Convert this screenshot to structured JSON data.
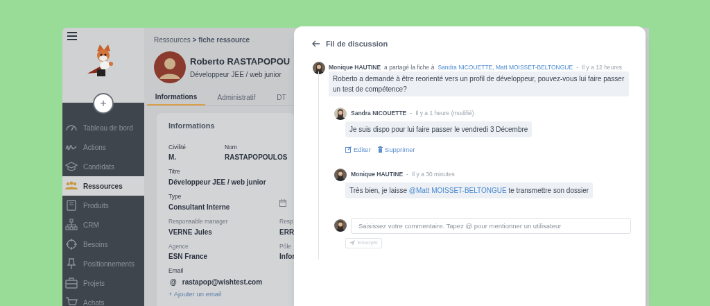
{
  "sidebar": {
    "nav": [
      {
        "label": "Tableau de bord",
        "selected": false
      },
      {
        "label": "Actions",
        "selected": false
      },
      {
        "label": "Candidats",
        "selected": false
      },
      {
        "label": "Ressources",
        "selected": true
      },
      {
        "label": "Produits",
        "selected": false
      },
      {
        "label": "CRM",
        "selected": false
      },
      {
        "label": "Besoins",
        "selected": false
      },
      {
        "label": "Positionnements",
        "selected": false
      },
      {
        "label": "Projets",
        "selected": false
      },
      {
        "label": "Achats",
        "selected": false
      }
    ]
  },
  "main": {
    "breadcrumb": "Ressources **> fiche ressource**",
    "profile": {
      "name": "Roberto RASTAPOPOU",
      "subtitle": "Développeur JEE / web junior"
    },
    "tabs": [
      {
        "label": "Informations",
        "selected": true
      },
      {
        "label": "Administratif",
        "selected": false
      },
      {
        "label": "DT",
        "selected": false
      }
    ],
    "card": {
      "title": "Informations",
      "rows": [
        [
          {
            "label": "Civilité",
            "value": "M."
          },
          {
            "label": "Nom",
            "value": "RASTAPOPOULOS"
          }
        ],
        [
          {
            "label": "Titre",
            "value": "Développeur JEE / web junior"
          }
        ],
        [
          {
            "label": "Type",
            "value": "Consultant Interne"
          },
          {
            "kind": "date"
          }
        ],
        [
          {
            "label": "Responsable manager",
            "value": "VERNE Jules"
          },
          {
            "label": "Resp",
            "value": "ERR"
          }
        ],
        [
          {
            "label": "Agence",
            "value": "ESN France"
          },
          {
            "label": "Pôle",
            "value": "Infor"
          }
        ]
      ],
      "email": {
        "label": "Email",
        "prefix": "@",
        "value": "rastapop@wishtest.com",
        "add": "+ Ajouter un email"
      }
    }
  },
  "discussion": {
    "title": "Fil de discussion",
    "comment": {
      "author": "Monique HAUTINE",
      "action": "a partagé la fiche à",
      "recipients": "Sandra NICOUETTE, Matt MOISSET-BELTONGUE",
      "separator": "-",
      "time": "Il y a 12 heures",
      "text": [
        {
          "kind": "text",
          "text": "Roberto a demandé à être reorienté vers un profil de développeur, pouvez-vous lui faire passer un test de compétence?"
        }
      ],
      "replies": [
        {
          "author": "Sandra NICOUETTE",
          "separator": "-",
          "time": "Il y a 1 heure (modifié)",
          "text": [
            {
              "kind": "text",
              "text": "Je suis dispo pour lui faire passer le vendredi 3 Décembre"
            }
          ],
          "actions": [
            "Editer",
            "Supprimer"
          ]
        },
        {
          "author": "Monique HAUTINE",
          "separator": "-",
          "time": "Il y a 30 minutes",
          "text": [
            {
              "kind": "text",
              "text": "Très bien, je laisse "
            },
            {
              "kind": "mention",
              "text": "@Matt MOISSET-BELTONGUE"
            },
            {
              "kind": "text",
              "text": " te transmettre son dossier"
            }
          ]
        }
      ]
    },
    "composer": {
      "placeholder": "Saisissez votre commentaire. Tapez @ pour mentionner un utilisateur",
      "button": "Envoyer",
      "disabled": true
    }
  }
}
